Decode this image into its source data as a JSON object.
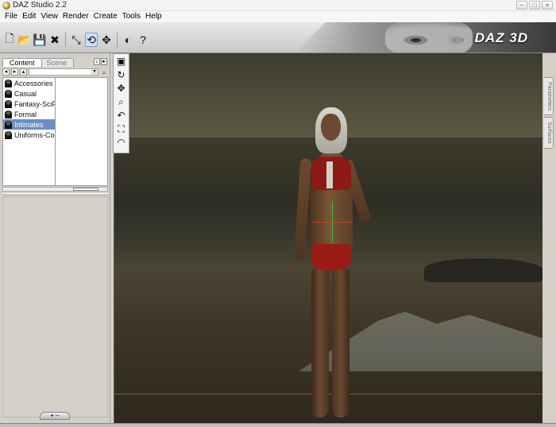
{
  "window": {
    "title": "DAZ Studio 2.2",
    "controls": [
      "–",
      "□",
      "×"
    ]
  },
  "menubar": {
    "items": [
      "File",
      "Edit",
      "View",
      "Render",
      "Create",
      "Tools",
      "Help"
    ]
  },
  "toolbar": {
    "logo_text": "DAZ 3D"
  },
  "content_panel": {
    "tabs": [
      "Content",
      "Scene"
    ],
    "folders": [
      {
        "label": "Accessories",
        "selected": false
      },
      {
        "label": "Casual",
        "selected": false
      },
      {
        "label": "Fantasy-SciFi",
        "selected": false
      },
      {
        "label": "Formal",
        "selected": false
      },
      {
        "label": "Intimates",
        "selected": true
      },
      {
        "label": "Uniforms-Costume",
        "selected": false
      }
    ],
    "bottom_tab": "+ –"
  },
  "side_tabs": [
    "Parameters",
    "Surfaces"
  ]
}
